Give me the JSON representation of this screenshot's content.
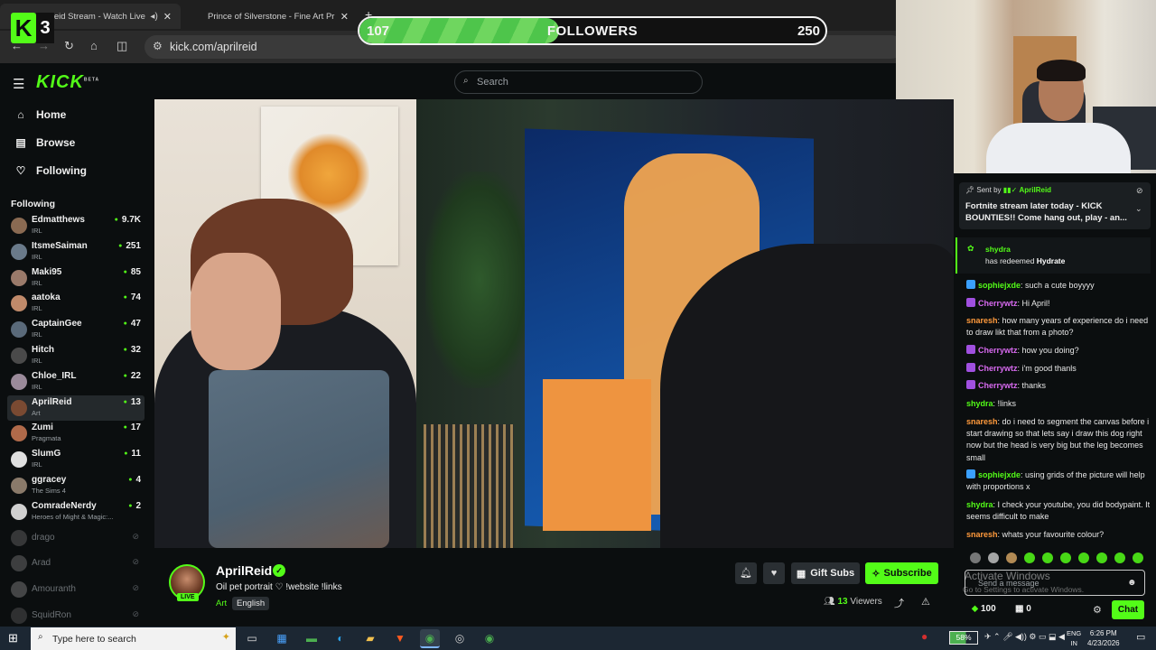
{
  "browser": {
    "tabs": [
      {
        "title": "AprilReid Stream - Watch Live on Kick",
        "active": true
      },
      {
        "title": "Prince of Silverstone - Fine Art Print |",
        "active": false
      }
    ],
    "new_tab_label": "+",
    "url": "kick.com/aprilreid"
  },
  "overlay": {
    "badge_letter": "K",
    "badge_count": "3",
    "followers_goal": {
      "current": "107",
      "label": "FOLLOWERS",
      "target": "250",
      "progress_fraction": 0.428
    }
  },
  "header": {
    "logo": "KICK",
    "logo_sup": "BETA",
    "search_placeholder": "Search"
  },
  "sidebar": {
    "nav": [
      {
        "label": "Home",
        "icon": "home-icon"
      },
      {
        "label": "Browse",
        "icon": "browse-icon"
      },
      {
        "label": "Following",
        "icon": "heart-icon"
      }
    ],
    "following_heading": "Following",
    "following": [
      {
        "name": "Edmatthews",
        "category": "IRL",
        "viewers": "9.7K",
        "live": true,
        "color": "#8a6a52"
      },
      {
        "name": "ItsmeSaiman",
        "category": "IRL",
        "viewers": "251",
        "live": true,
        "color": "#6a7a8a"
      },
      {
        "name": "Maki95",
        "category": "IRL",
        "viewers": "85",
        "live": true,
        "color": "#9a7a6a"
      },
      {
        "name": "aatoka",
        "category": "IRL",
        "viewers": "74",
        "live": true,
        "color": "#c08a6a"
      },
      {
        "name": "CaptainGee",
        "category": "IRL",
        "viewers": "47",
        "live": true,
        "color": "#5a6a7a"
      },
      {
        "name": "Hitch",
        "category": "IRL",
        "viewers": "32",
        "live": true,
        "color": "#4a4a4a"
      },
      {
        "name": "Chloe_IRL",
        "category": "IRL",
        "viewers": "22",
        "live": true,
        "color": "#9a8a9a"
      },
      {
        "name": "AprilReid",
        "category": "Art",
        "viewers": "13",
        "live": true,
        "selected": true,
        "color": "#7a4a32"
      },
      {
        "name": "Zumi",
        "category": "Pragmata",
        "viewers": "17",
        "live": true,
        "color": "#b06a4a"
      },
      {
        "name": "SlumG",
        "category": "IRL",
        "viewers": "11",
        "live": true,
        "color": "#e0e0e0"
      },
      {
        "name": "ggracey",
        "category": "The Sims 4",
        "viewers": "4",
        "live": true,
        "color": "#8a7a6a"
      },
      {
        "name": "ComradeNerdy",
        "category": "Heroes of Might & Magic:...",
        "viewers": "2",
        "live": true,
        "color": "#d0d0d0"
      },
      {
        "name": "drago",
        "category": "",
        "viewers": "",
        "live": false,
        "color": "#6a6a6a"
      },
      {
        "name": "Arad",
        "category": "",
        "viewers": "",
        "live": false,
        "color": "#7a7a7a"
      },
      {
        "name": "Amouranth",
        "category": "",
        "viewers": "",
        "live": false,
        "color": "#8a8a8a"
      },
      {
        "name": "SquidRon",
        "category": "",
        "viewers": "",
        "live": false,
        "color": "#5a5a5a"
      }
    ]
  },
  "stream": {
    "streamer": "AprilReid",
    "live_label": "LIVE",
    "title": "Oil pet portrait ♡ !website !links",
    "category": "Art",
    "language": "English",
    "viewers_count": "13",
    "viewers_label": "Viewers",
    "gift_subs_label": "Gift Subs",
    "subscribe_label": "Subscribe"
  },
  "chat": {
    "pinned": {
      "sent_by_label": "Sent by",
      "sender": "AprilReid",
      "text": "Fortnite stream later today - KICK BOUNTIES!! Come hang out, play - an..."
    },
    "redeem": {
      "user": "shydra",
      "text_prefix": "has redeemed",
      "reward": "Hydrate"
    },
    "messages": [
      {
        "user": "sophiejxde",
        "color": "#53fc18",
        "badge": "#3aa0ff",
        "text": "such a cute boyyyy"
      },
      {
        "user": "Cherrywtz",
        "color": "#d86af0",
        "badge": "#a050e0",
        "text": "Hi April!"
      },
      {
        "user": "snaresh",
        "color": "#ff9a3c",
        "badge": "",
        "text": "how many years of experience do i need to draw likt that from a photo?"
      },
      {
        "user": "Cherrywtz",
        "color": "#d86af0",
        "badge": "#a050e0",
        "text": "how you doing?"
      },
      {
        "user": "Cherrywtz",
        "color": "#d86af0",
        "badge": "#a050e0",
        "text": "i'm good thanls"
      },
      {
        "user": "Cherrywtz",
        "color": "#d86af0",
        "badge": "#a050e0",
        "text": "thanks"
      },
      {
        "user": "shydra",
        "color": "#53fc18",
        "badge": "",
        "text": "!links"
      },
      {
        "user": "snaresh",
        "color": "#ff9a3c",
        "badge": "",
        "text": "do i need to segment the canvas before i start drawing so that lets say i draw this dog right now but the head is very big but the leg becomes small"
      },
      {
        "user": "sophiejxde",
        "color": "#53fc18",
        "badge": "#3aa0ff",
        "text": "using grids of the picture will help with proportions x"
      },
      {
        "user": "shydra",
        "color": "#53fc18",
        "badge": "",
        "text": "I check your youtube, you did bodypaint. It seems difficult to make"
      },
      {
        "user": "snaresh",
        "color": "#ff9a3c",
        "badge": "",
        "text": "whats your favourite colour?"
      }
    ],
    "input_placeholder": "Send a message",
    "points": "100",
    "gifts": "0",
    "chat_button": "Chat",
    "watermark_title": "Activate Windows",
    "watermark_sub": "Go to Settings to activate Windows."
  },
  "taskbar": {
    "search_placeholder": "Type here to search",
    "battery": "58%",
    "lang_top": "ENG",
    "lang_bottom": "IN",
    "time": "6:26 PM",
    "date": "4/23/2026"
  }
}
